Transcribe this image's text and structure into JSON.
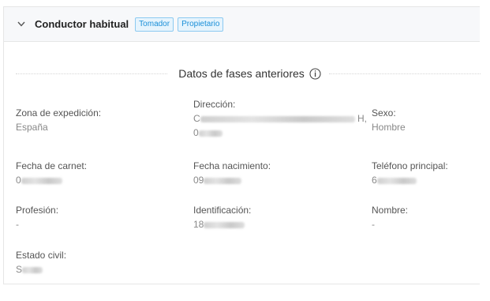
{
  "header": {
    "title": "Conductor habitual",
    "tags": [
      "Tomador",
      "Propietario"
    ]
  },
  "section": {
    "title": "Datos de fases anteriores"
  },
  "fields": {
    "zona": {
      "label": "Zona de expedición:",
      "value": "España"
    },
    "direccion": {
      "label": "Dirección:",
      "value_prefix": "C",
      "value_suffix": "H,",
      "value_line2_prefix": "0"
    },
    "sexo": {
      "label": "Sexo:",
      "value": "Hombre"
    },
    "fecha_carnet": {
      "label": "Fecha de carnet:",
      "value_prefix": "0"
    },
    "fecha_nacimiento": {
      "label": "Fecha nacimiento:",
      "value_prefix": "09"
    },
    "telefono": {
      "label": "Teléfono principal:",
      "value_prefix": "6"
    },
    "profesion": {
      "label": "Profesión:",
      "value": "-"
    },
    "identificacion": {
      "label": "Identificación:",
      "value_prefix": "18"
    },
    "nombre": {
      "label": "Nombre:",
      "value": "-"
    },
    "estado_civil": {
      "label": "Estado civil:",
      "value_prefix": "S"
    }
  },
  "colors": {
    "tag_text": "#1a8fd8",
    "tag_bg": "#e6f4fd",
    "tag_border": "#8ccaf1",
    "header_bg": "#f7f8fa"
  },
  "icons": {
    "collapse": "chevron-down-icon",
    "info": "info-circle-icon"
  }
}
